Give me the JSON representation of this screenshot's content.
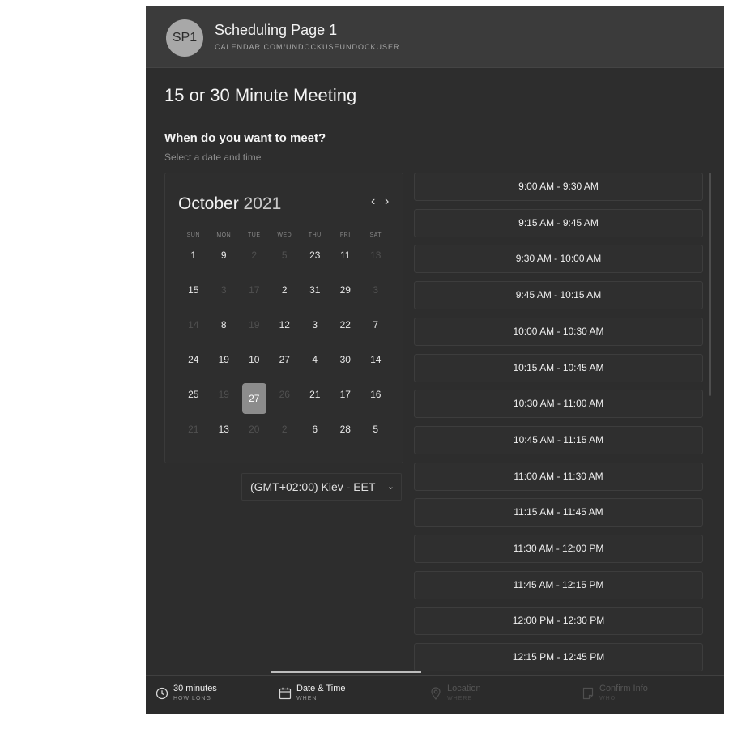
{
  "header": {
    "avatar_initials": "SP1",
    "title": "Scheduling Page 1",
    "url": "CALENDAR.COM/UNDOCKUSEUNDOCKUSER"
  },
  "meeting": {
    "title": "15 or 30 Minute Meeting",
    "question": "When do you want to meet?",
    "hint": "Select a date and time"
  },
  "calendar": {
    "month": "October",
    "year": "2021",
    "prev_icon": "chevron-left-icon",
    "next_icon": "chevron-right-icon",
    "weekdays": [
      "SUN",
      "MON",
      "TUE",
      "WED",
      "THU",
      "FRI",
      "SAT"
    ],
    "rows": [
      [
        {
          "d": "1"
        },
        {
          "d": "9"
        },
        {
          "d": "2",
          "dim": true
        },
        {
          "d": "5",
          "dim": true
        },
        {
          "d": "23"
        },
        {
          "d": "11"
        },
        {
          "d": "13",
          "dim": true
        }
      ],
      [
        {
          "d": "15"
        },
        {
          "d": "3",
          "dim": true
        },
        {
          "d": "17",
          "dim": true
        },
        {
          "d": "2"
        },
        {
          "d": "31"
        },
        {
          "d": "29"
        },
        {
          "d": "3",
          "dim": true
        }
      ],
      [
        {
          "d": "14",
          "dim": true
        },
        {
          "d": "8"
        },
        {
          "d": "19",
          "dim": true
        },
        {
          "d": "12"
        },
        {
          "d": "3"
        },
        {
          "d": "22"
        },
        {
          "d": "7"
        }
      ],
      [
        {
          "d": "24"
        },
        {
          "d": "19"
        },
        {
          "d": "10"
        },
        {
          "d": "27"
        },
        {
          "d": "4"
        },
        {
          "d": "30"
        },
        {
          "d": "14"
        }
      ],
      [
        {
          "d": "25"
        },
        {
          "d": "19",
          "dim": true
        },
        {
          "d": "27",
          "selected": true
        },
        {
          "d": "26",
          "dim": true
        },
        {
          "d": "21"
        },
        {
          "d": "17"
        },
        {
          "d": "16"
        }
      ],
      [
        {
          "d": "21",
          "dim": true
        },
        {
          "d": "13"
        },
        {
          "d": "20",
          "dim": true
        },
        {
          "d": "2",
          "dim": true
        },
        {
          "d": "6"
        },
        {
          "d": "28"
        },
        {
          "d": "5"
        }
      ]
    ]
  },
  "timezone": {
    "value": "(GMT+02:00) Kiev - EET",
    "chevron_icon": "chevron-down-icon"
  },
  "slots": [
    "9:00 AM - 9:30 AM",
    "9:15 AM - 9:45 AM",
    "9:30 AM - 10:00 AM",
    "9:45 AM - 10:15 AM",
    "10:00 AM - 10:30 AM",
    "10:15 AM - 10:45 AM",
    "10:30 AM - 11:00 AM",
    "10:45 AM - 11:15 AM",
    "11:00 AM - 11:30 AM",
    "11:15 AM - 11:45 AM",
    "11:30 AM - 12:00 PM",
    "11:45 AM - 12:15 PM",
    "12:00 PM - 12:30 PM",
    "12:15 PM - 12:45 PM"
  ],
  "footer": {
    "steps": [
      {
        "label": "30 minutes",
        "sub": "HOW LONG",
        "icon": "clock-icon",
        "active": true
      },
      {
        "label": "Date & Time",
        "sub": "WHEN",
        "icon": "calendar-icon",
        "active": true
      },
      {
        "label": "Location",
        "sub": "WHERE",
        "icon": "location-pin-icon",
        "active": false
      },
      {
        "label": "Confirm Info",
        "sub": "WHO",
        "icon": "document-icon",
        "active": false
      }
    ]
  },
  "colors": {
    "background": "#2d2d2d",
    "header": "#3b3b3b",
    "selected_day": "#8c8c8c"
  }
}
